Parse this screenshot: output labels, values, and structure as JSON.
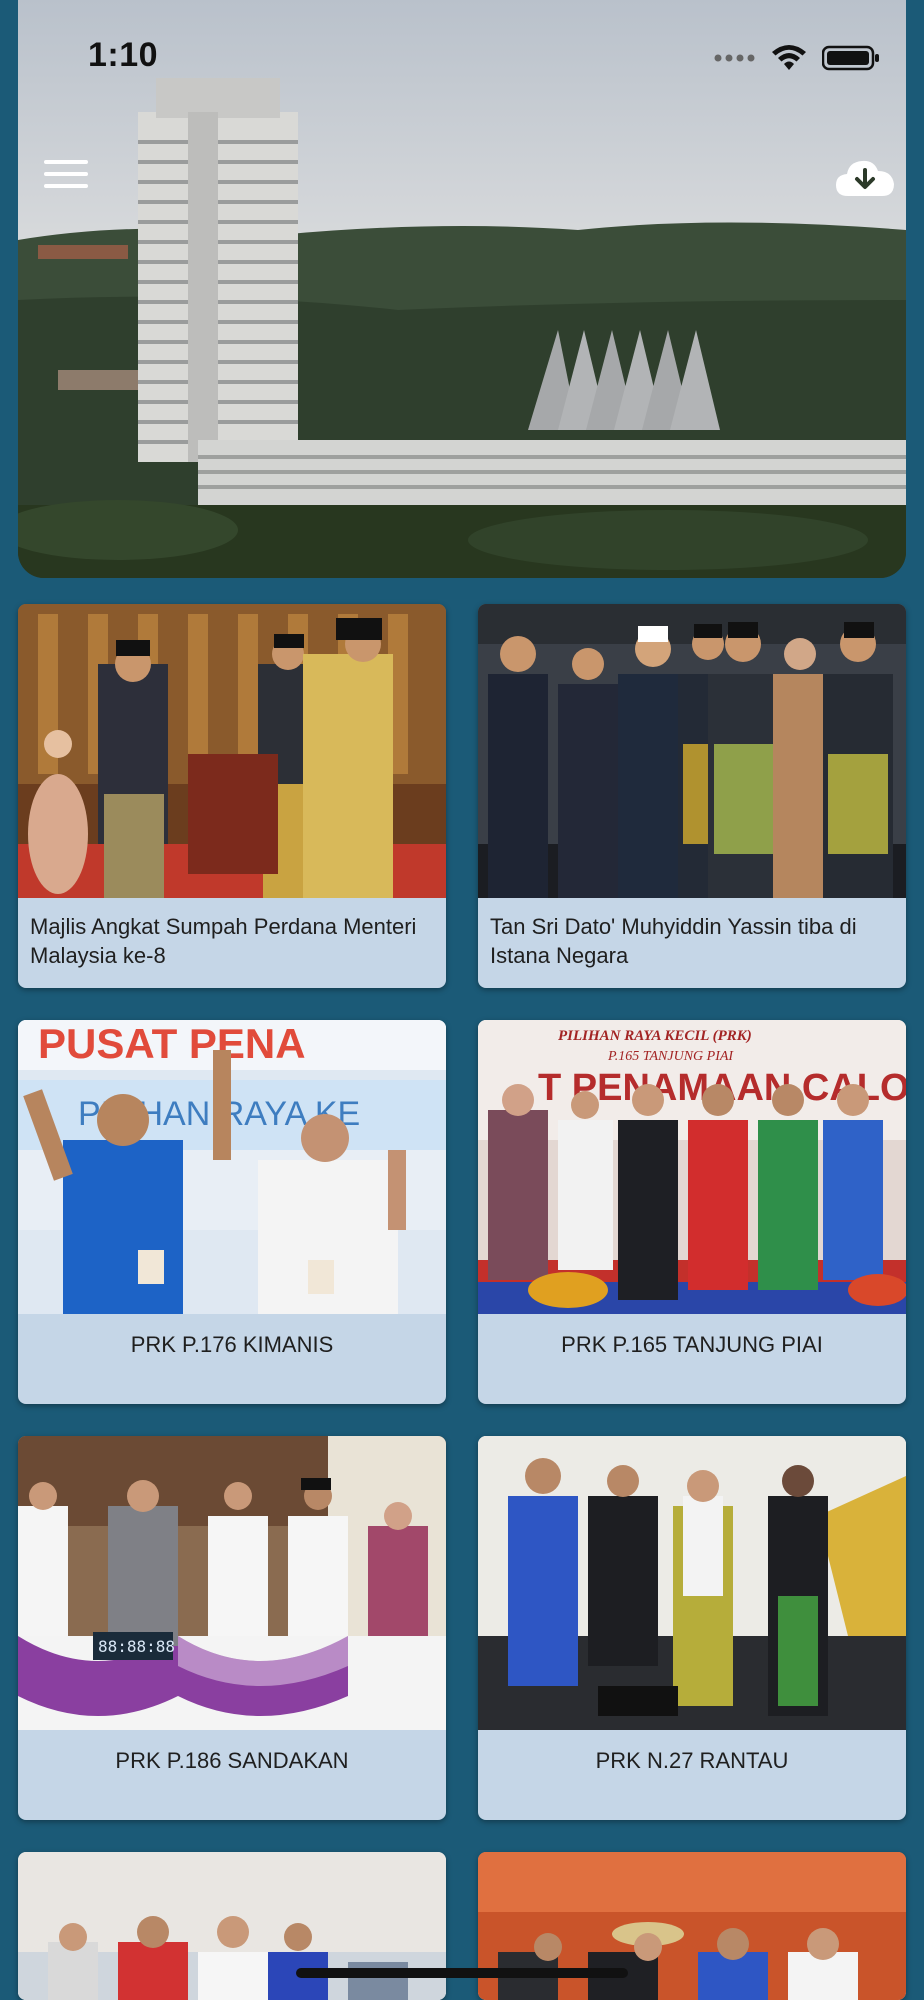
{
  "status_bar": {
    "time": "1:10"
  },
  "header": {
    "menu_icon": "hamburger-menu-icon",
    "download_icon": "cloud-download-icon"
  },
  "cards": [
    {
      "caption": "Majlis Angkat Sumpah Perdana Menteri Malaysia ke-8",
      "align": "left"
    },
    {
      "caption": "Tan Sri Dato' Muhyiddin Yassin tiba di Istana Negara",
      "align": "left"
    },
    {
      "caption": "PRK P.176 KIMANIS",
      "align": "center"
    },
    {
      "caption": "PRK P.165 TANJUNG PIAI",
      "align": "center"
    },
    {
      "caption": "PRK P.186 SANDAKAN",
      "align": "center"
    },
    {
      "caption": "PRK N.27 RANTAU",
      "align": "center"
    }
  ],
  "banners": {
    "kimanis_top": "PUSAT PENA",
    "kimanis_sub": "PILIHAN RAYA KE",
    "piai_top": "PILIHAN RAYA KECIL (PRK)",
    "piai_sub": "P.165 TANJUNG PIAI",
    "piai_center": "T PENAMAAN CALON",
    "sandakan_clock": "88:88:88"
  },
  "colors": {
    "background": "#1b5a77",
    "card": "#c5d6e7",
    "caption_text": "#1f1f1f"
  }
}
